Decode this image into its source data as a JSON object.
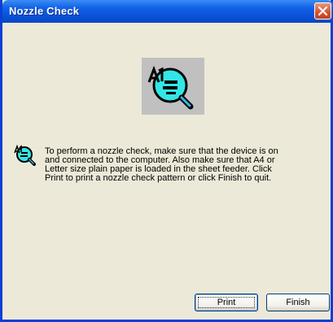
{
  "window": {
    "title": "Nozzle Check"
  },
  "icons": {
    "banner": "nozzle-check-magnifier-icon",
    "message": "nozzle-check-small-icon",
    "close": "close-icon"
  },
  "message": {
    "text": "To perform a nozzle check, make sure that the device is on and connected to the computer. Also make sure that A4 or Letter size plain paper is loaded in the sheet feeder. Click Print to print a nozzle check pattern or click Finish to quit."
  },
  "buttons": {
    "print_label": "Print",
    "finish_label": "Finish"
  },
  "colors": {
    "titlebar": "#0a52d8",
    "dialog_bg": "#ece9d8",
    "close_button": "#d6512e",
    "icon_cyan": "#33e6e6"
  }
}
